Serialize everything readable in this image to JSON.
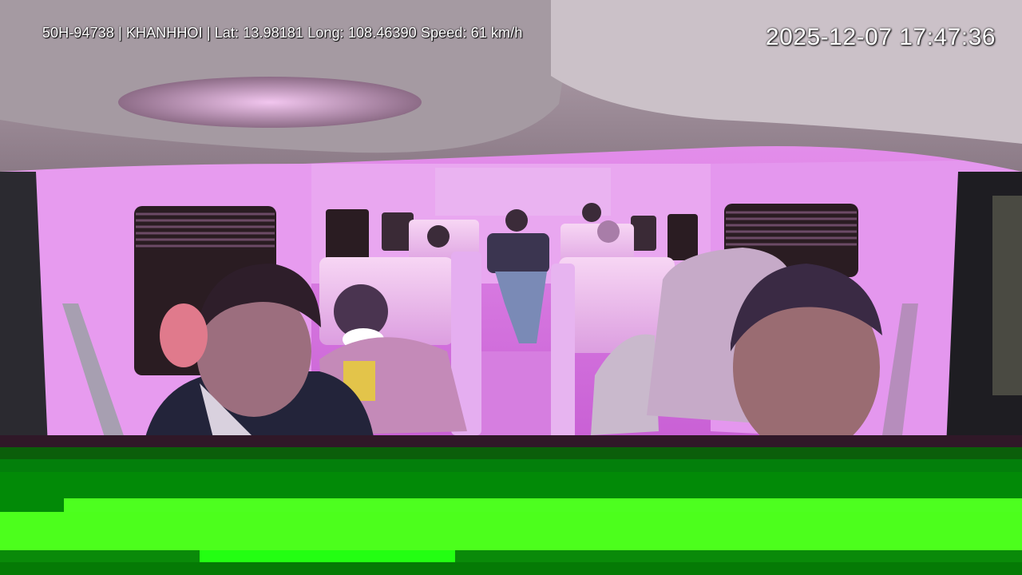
{
  "overlay": {
    "info_text": "50H-94738 | KHANHHOI | Lat: 13.98181 Long: 108.46390 Speed: 61 km/h",
    "timestamp": "2025-12-07 17:47:36"
  },
  "colors": {
    "cabin_tint": "#d97fe6",
    "glitch_dark_green": "#027a07",
    "glitch_bright_green": "#4cff1c"
  }
}
